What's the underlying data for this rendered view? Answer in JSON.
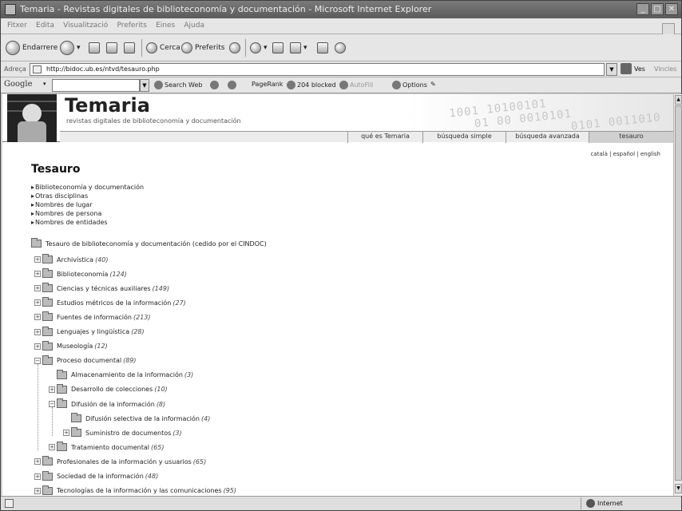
{
  "window": {
    "title": "Temaria - Revistas digitales de biblioteconomía y documentación - Microsoft Internet Explorer",
    "min": "_",
    "max": "□",
    "close": "✕"
  },
  "menu": [
    "Fitxer",
    "Edita",
    "Visualització",
    "Preferits",
    "Eines",
    "Ajuda"
  ],
  "toolbar": {
    "back": "Endarrere",
    "search": "Cerca",
    "favorites": "Preferits"
  },
  "address": {
    "label": "Adreça",
    "url": "http://bidoc.ub.es/ntvd/tesauro.php",
    "go": "Ves",
    "links": "Vincles"
  },
  "google": {
    "logo": "Google",
    "search_web": "Search Web",
    "pagerank": "PageRank",
    "blocked": "204 blocked",
    "autofill": "AutoFill",
    "options": "Options"
  },
  "site": {
    "title": "Temaria",
    "subtitle": "revistas digitales de biblioteconomía y documentación",
    "binary": [
      "1001  10100101",
      "01  00  0010101",
      "0101 0011010"
    ],
    "nav": [
      "qué es Temaria",
      "búsqueda simple",
      "búsqueda avanzada",
      "tesauro"
    ],
    "langs": "català | español | english"
  },
  "page": {
    "title": "Tesauro",
    "categories": [
      "Biblioteconomía y documentación",
      "Otras disciplinas",
      "Nombres de lugar",
      "Nombres de persona",
      "Nombres de entidades"
    ],
    "tree_root": "Tesauro de biblioteconomía y documentación (cedido por el CINDOC)",
    "tree": [
      {
        "label": "Archivística",
        "count": "(40)",
        "level": 0,
        "sign": "+"
      },
      {
        "label": "Biblioteconomía",
        "count": "(124)",
        "level": 0,
        "sign": "+"
      },
      {
        "label": "Ciencias y técnicas auxiliares",
        "count": "(149)",
        "level": 0,
        "sign": "+"
      },
      {
        "label": "Estudios métricos de la información",
        "count": "(27)",
        "level": 0,
        "sign": "+"
      },
      {
        "label": "Fuentes de información",
        "count": "(213)",
        "level": 0,
        "sign": "+"
      },
      {
        "label": "Lenguajes y lingüística",
        "count": "(28)",
        "level": 0,
        "sign": "+"
      },
      {
        "label": "Museología",
        "count": "(12)",
        "level": 0,
        "sign": "+"
      },
      {
        "label": "Proceso documental",
        "count": "(89)",
        "level": 0,
        "sign": "−"
      },
      {
        "label": "Almacenamiento de la información",
        "count": "(3)",
        "level": 1,
        "sign": ""
      },
      {
        "label": "Desarrollo de colecciones",
        "count": "(10)",
        "level": 1,
        "sign": "+"
      },
      {
        "label": "Difusión de la información",
        "count": "(8)",
        "level": 1,
        "sign": "−"
      },
      {
        "label": "Difusión selectiva de la información",
        "count": "(4)",
        "level": 2,
        "sign": ""
      },
      {
        "label": "Suministro de documentos",
        "count": "(3)",
        "level": 2,
        "sign": "+"
      },
      {
        "label": "Tratamiento documental",
        "count": "(65)",
        "level": 1,
        "sign": "+"
      },
      {
        "label": "Profesionales de la información y usuarios",
        "count": "(65)",
        "level": 0,
        "sign": "+"
      },
      {
        "label": "Sociedad de la información",
        "count": "(48)",
        "level": 0,
        "sign": "+"
      },
      {
        "label": "Tecnologías de la información y las comunicaciones",
        "count": "(95)",
        "level": 0,
        "sign": "+"
      }
    ]
  },
  "status": {
    "zone": "Internet"
  }
}
